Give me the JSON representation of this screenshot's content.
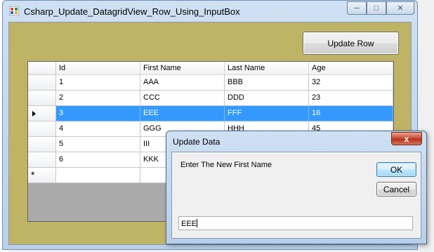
{
  "window": {
    "title": "Csharp_Update_DatagridView_Row_Using_InputBox",
    "minimize_glyph": "─",
    "maximize_glyph": "□",
    "close_glyph": "✕"
  },
  "toolbar": {
    "update_label": "Update Row"
  },
  "grid": {
    "columns": [
      "Id",
      "First Name",
      "Last Name",
      "Age"
    ],
    "rows": [
      [
        "1",
        "AAA",
        "BBB",
        "32"
      ],
      [
        "2",
        "CCC",
        "DDD",
        "23"
      ],
      [
        "3",
        "EEE",
        "FFF",
        "16"
      ],
      [
        "4",
        "GGG",
        "HHH",
        "45"
      ],
      [
        "5",
        "III",
        "",
        ""
      ],
      [
        "6",
        "KKK",
        "",
        ""
      ]
    ],
    "selected_row": 2,
    "new_row_glyph": "*"
  },
  "dialog": {
    "title": "Update Data",
    "close_glyph": "x",
    "prompt": "Enter The New First Name",
    "ok_label": "OK",
    "cancel_label": "Cancel",
    "input_value": "EEE"
  },
  "colors": {
    "selection": "#3399ff",
    "form_background": "#bfb365"
  }
}
